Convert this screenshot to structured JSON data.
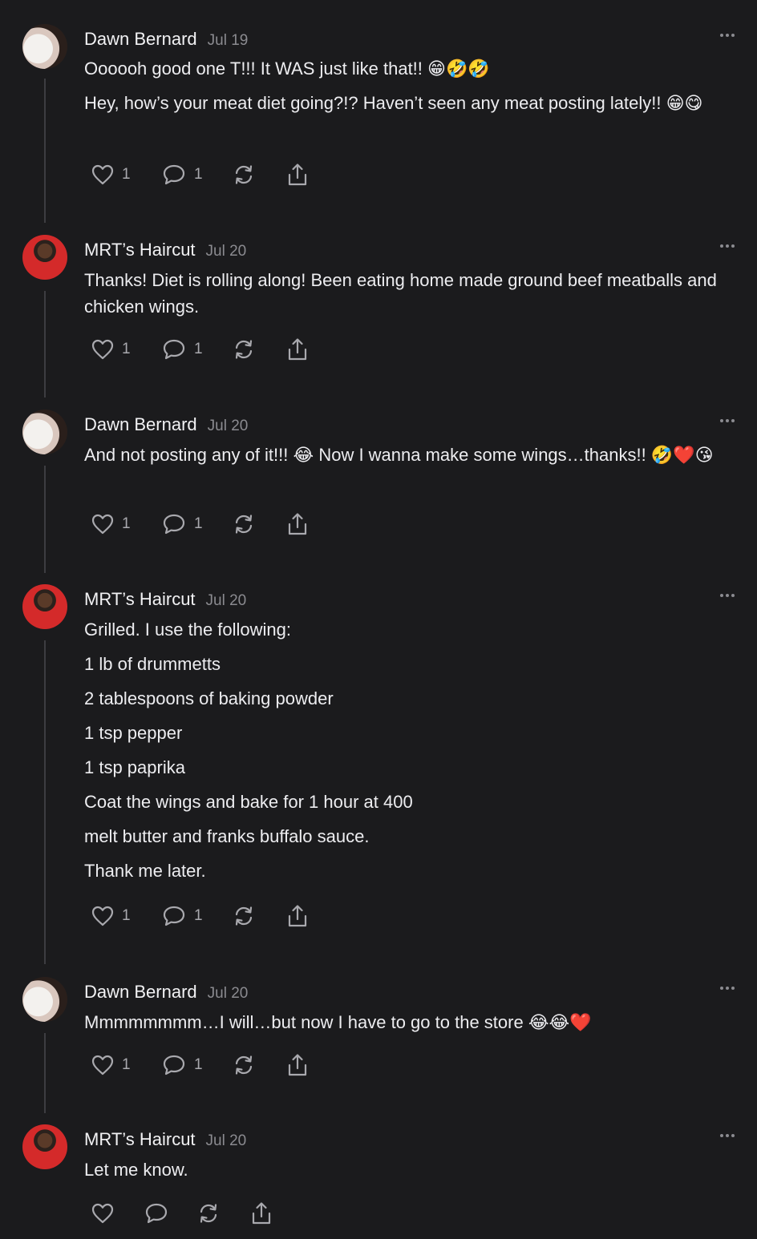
{
  "posts": [
    {
      "author": "Dawn Bernard",
      "date": "Jul 19",
      "paragraphs": [
        "Oooooh good one T!!! It WAS just like that!! 😁🤣🤣",
        "Hey, how’s your meat diet going?!? Haven’t seen any meat posting lately!! 😁😋"
      ],
      "likes": "1",
      "replies": "1"
    },
    {
      "author": "MRT’s Haircut",
      "date": "Jul 20",
      "paragraphs": [
        "Thanks! Diet is rolling along! Been eating home made ground beef meatballs and chicken wings."
      ],
      "likes": "1",
      "replies": "1"
    },
    {
      "author": "Dawn Bernard",
      "date": "Jul 20",
      "paragraphs": [
        "And not posting any of it!!! 😂 Now I wanna make some wings…thanks!! 🤣❤️😘"
      ],
      "likes": "1",
      "replies": "1"
    },
    {
      "author": "MRT’s Haircut",
      "date": "Jul 20",
      "paragraphs": [
        "Grilled. I use the following:",
        "1 lb of drummetts",
        "2 tablespoons of baking powder",
        "1 tsp pepper",
        "1 tsp paprika",
        "Coat the wings and bake for 1 hour at 400",
        "melt butter and franks buffalo sauce.",
        "Thank me later."
      ],
      "likes": "1",
      "replies": "1"
    },
    {
      "author": "Dawn Bernard",
      "date": "Jul 20",
      "paragraphs": [
        "Mmmmmmmm…I will…but now I have to go to the store 😂😂❤️"
      ],
      "likes": "1",
      "replies": "1"
    },
    {
      "author": "MRT’s Haircut",
      "date": "Jul 20",
      "paragraphs": [
        "Let me know."
      ]
    }
  ],
  "icons": {
    "like": "heart-icon",
    "reply": "comment-icon",
    "repost": "repost-icon",
    "share": "share-icon",
    "more": "more-icon"
  },
  "colors": {
    "background": "#1b1b1d",
    "text": "#ededf0",
    "muted": "#8b8b90",
    "thread_line": "#3d3d41"
  }
}
